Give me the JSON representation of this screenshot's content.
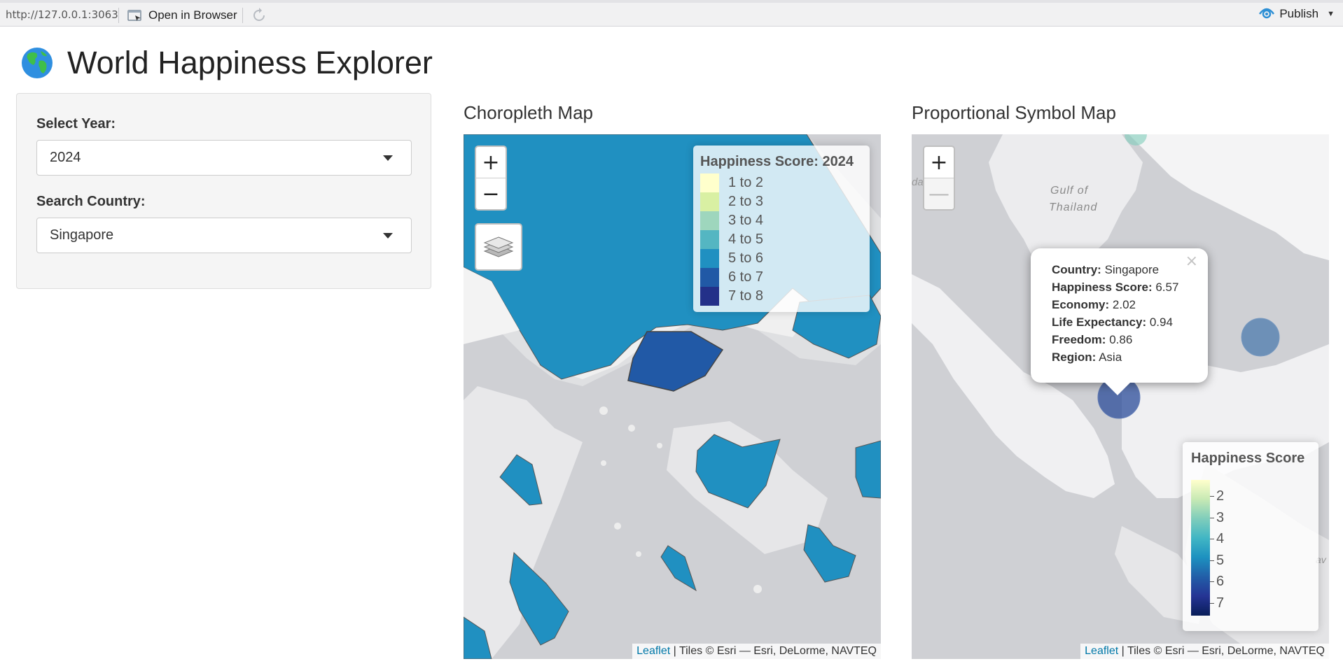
{
  "toolbar": {
    "url": "http://127.0.0.1:3063",
    "open_in_browser": "Open in Browser",
    "publish": "Publish"
  },
  "page": {
    "title": "World Happiness Explorer",
    "icon": "globe-icon"
  },
  "sidebar": {
    "year_label": "Select Year:",
    "year_value": "2024",
    "country_label": "Search Country:",
    "country_value": "Singapore"
  },
  "choropleth": {
    "title": "Choropleth Map",
    "zoom_in": "+",
    "zoom_out": "−",
    "legend": {
      "title": "Happiness Score: 2024",
      "items": [
        {
          "label": "1 to 2",
          "color": "#ffffcc"
        },
        {
          "label": "2 to 3",
          "color": "#d9f0a3"
        },
        {
          "label": "3 to 4",
          "color": "#9ed6bd"
        },
        {
          "label": "4 to 5",
          "color": "#54b6c2"
        },
        {
          "label": "5 to 6",
          "color": "#2090c1"
        },
        {
          "label": "6 to 7",
          "color": "#2159a6"
        },
        {
          "label": "7 to 8",
          "color": "#233089"
        }
      ]
    },
    "attribution_link": "Leaflet",
    "attribution_text": " | Tiles © Esri — Esri, DeLorme, NAVTEQ"
  },
  "symbol_map": {
    "title": "Proportional Symbol Map",
    "zoom_in": "+",
    "zoom_out": "—",
    "map_labels": {
      "sea": "da Sea",
      "gulf": "Gulf of",
      "thailand": "Thailand",
      "edge": "av"
    },
    "popup": {
      "close": "×",
      "rows": [
        {
          "key": "Country:",
          "value": "Singapore"
        },
        {
          "key": "Happiness Score:",
          "value": "6.57"
        },
        {
          "key": "Economy:",
          "value": "2.02"
        },
        {
          "key": "Life Expectancy:",
          "value": "0.94"
        },
        {
          "key": "Freedom:",
          "value": "0.86"
        },
        {
          "key": "Region:",
          "value": "Asia"
        }
      ]
    },
    "legend": {
      "title": "Happiness Score",
      "ticks": [
        "2",
        "3",
        "4",
        "5",
        "6",
        "7"
      ]
    },
    "attribution_link": "Leaflet",
    "attribution_text": " | Tiles © Esri — Esri, DeLorme, NAVTEQ"
  }
}
